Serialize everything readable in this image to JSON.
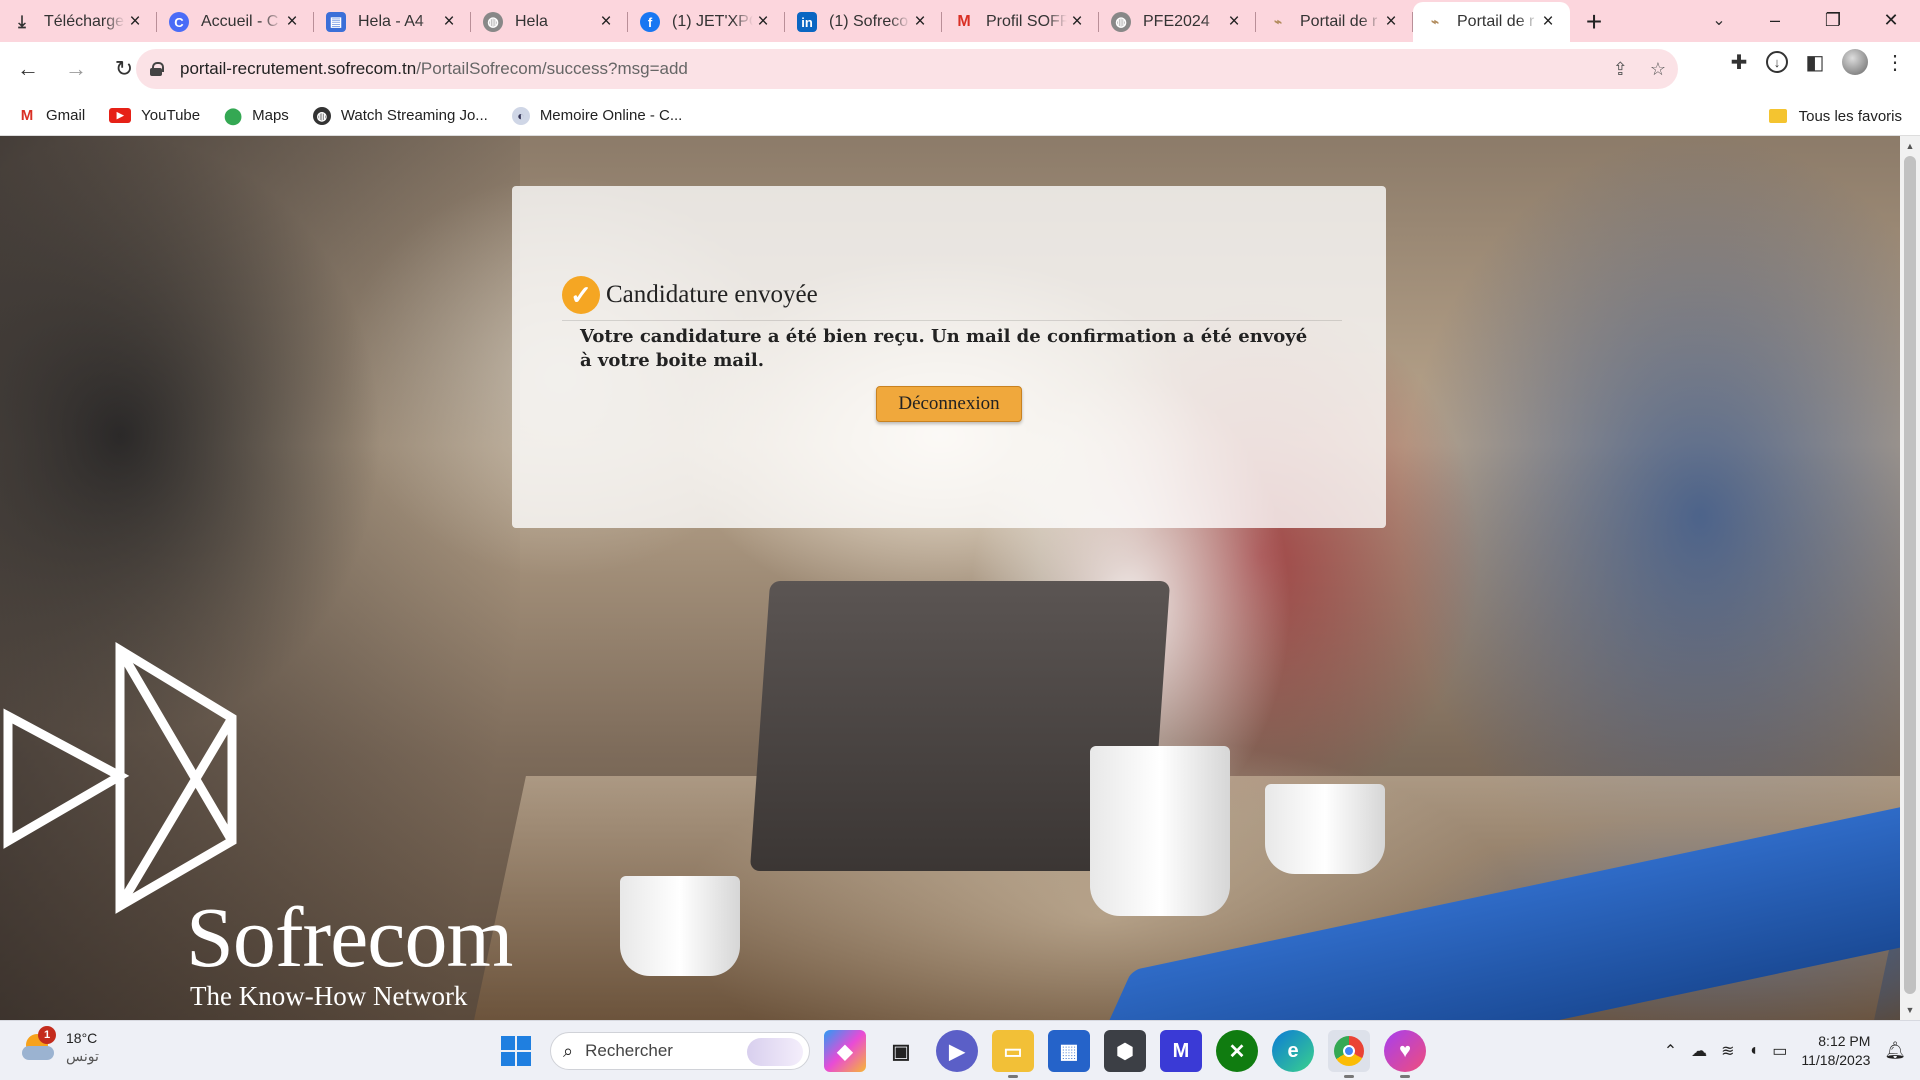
{
  "browser": {
    "tabs": [
      {
        "title": "Télécharge",
        "icon": "download-icon"
      },
      {
        "title": "Accueil - C",
        "icon": "c-logo-icon"
      },
      {
        "title": "Hela - A4",
        "icon": "printer-icon"
      },
      {
        "title": "Hela",
        "icon": "globe-icon"
      },
      {
        "title": "(1) JET'XPO",
        "icon": "facebook-icon"
      },
      {
        "title": "(1) Sofreco",
        "icon": "linkedin-icon"
      },
      {
        "title": "Profil SOFR",
        "icon": "gmail-icon"
      },
      {
        "title": "PFE2024",
        "icon": "globe-icon"
      },
      {
        "title": "Portail de r",
        "icon": "sofrecom-favicon-icon"
      },
      {
        "title": "Portail de r",
        "icon": "sofrecom-favicon-icon",
        "active": true
      }
    ],
    "url_domain": "portail-recrutement.sofrecom.tn",
    "url_path": "/PortailSofrecom/success?msg=add",
    "bookmarks": [
      {
        "label": "Gmail",
        "icon": "gmail-icon"
      },
      {
        "label": "YouTube",
        "icon": "youtube-icon"
      },
      {
        "label": "Maps",
        "icon": "maps-icon"
      },
      {
        "label": "Watch Streaming Jo...",
        "icon": "globe-icon"
      },
      {
        "label": "Memoire Online - C...",
        "icon": "memoire-icon"
      }
    ],
    "all_bookmarks_label": "Tous les favoris"
  },
  "page": {
    "card_title": "Candidature envoyée",
    "card_message": "Votre candidature a été bien reçu. Un mail de confirmation a été envoyé à votre boite mail.",
    "logout_button": "Déconnexion",
    "brand_name": "Sofrecom",
    "brand_tagline": "The Know-How Network",
    "accent_color": "#f5a623"
  },
  "taskbar": {
    "weather_temp": "18°C",
    "weather_city": "تونس",
    "weather_badge": "1",
    "search_placeholder": "Rechercher",
    "time": "8:12 PM",
    "date": "11/18/2023"
  }
}
